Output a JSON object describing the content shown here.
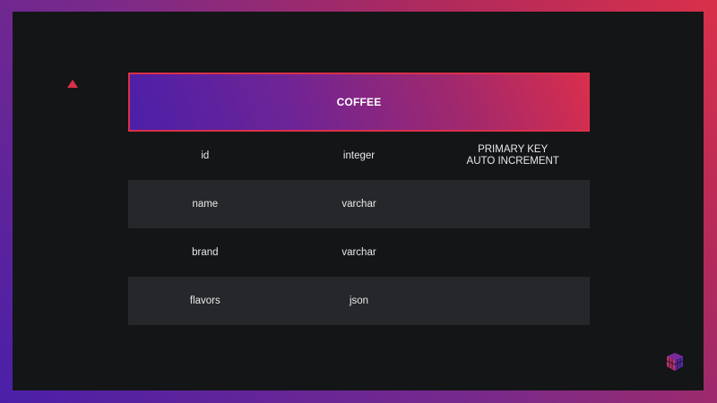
{
  "table": {
    "title": "COFFEE",
    "rows": [
      {
        "name": "id",
        "type": "integer",
        "constraints": "PRIMARY KEY\nAUTO INCREMENT"
      },
      {
        "name": "name",
        "type": "varchar",
        "constraints": ""
      },
      {
        "name": "brand",
        "type": "varchar",
        "constraints": ""
      },
      {
        "name": "flavors",
        "type": "json",
        "constraints": ""
      }
    ]
  },
  "colors": {
    "accent_red": "#d9304a",
    "accent_purple": "#4b1fa8",
    "background": "#141517",
    "row_shade": "#26272a"
  },
  "icons": [
    "triangle-decoration",
    "brand-logo-icon"
  ]
}
